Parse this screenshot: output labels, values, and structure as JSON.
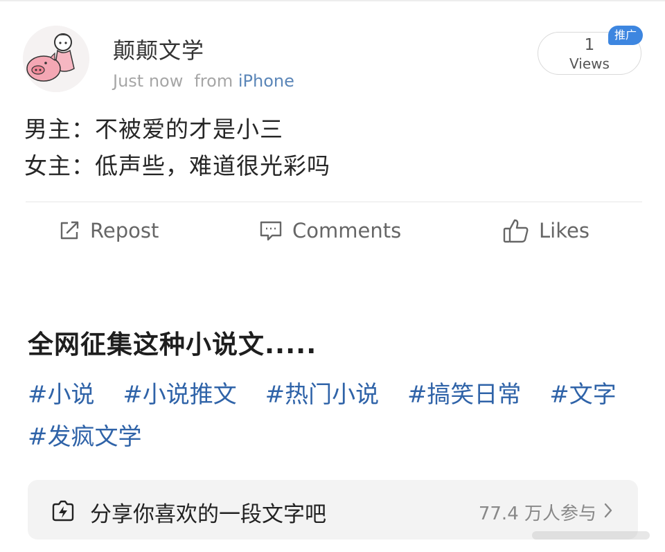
{
  "post": {
    "user_name": "颠颠文学",
    "time": "Just now",
    "source_prefix": "from",
    "source_device": "iPhone",
    "views_count": "1",
    "views_label": "Views",
    "promo_badge": "推广",
    "lines": [
      "男主：不被爱的才是小三",
      "女主：低声些，难道很光彩吗"
    ]
  },
  "actions": {
    "repost": "Repost",
    "comments": "Comments",
    "likes": "Likes"
  },
  "feature": {
    "headline": "全网征集这种小说文.....",
    "tags": [
      "#小说",
      "#小说推文",
      "#热门小说",
      "#搞笑日常",
      "#文字",
      "#发疯文学"
    ]
  },
  "topic": {
    "title": "分享你喜欢的一段文字吧",
    "participants": "77.4 万人参与"
  },
  "icons": {
    "repost": "edit-square-icon",
    "comments": "comment-bubble-icon",
    "likes": "thumbs-up-icon",
    "topic": "lightning-tag-icon",
    "chevron": "chevron-right-icon"
  },
  "colors": {
    "link_blue": "#2f63a8",
    "device_blue": "#5b86b8",
    "badge_blue": "#3d86e0",
    "muted_gray": "#a6a6a6"
  }
}
